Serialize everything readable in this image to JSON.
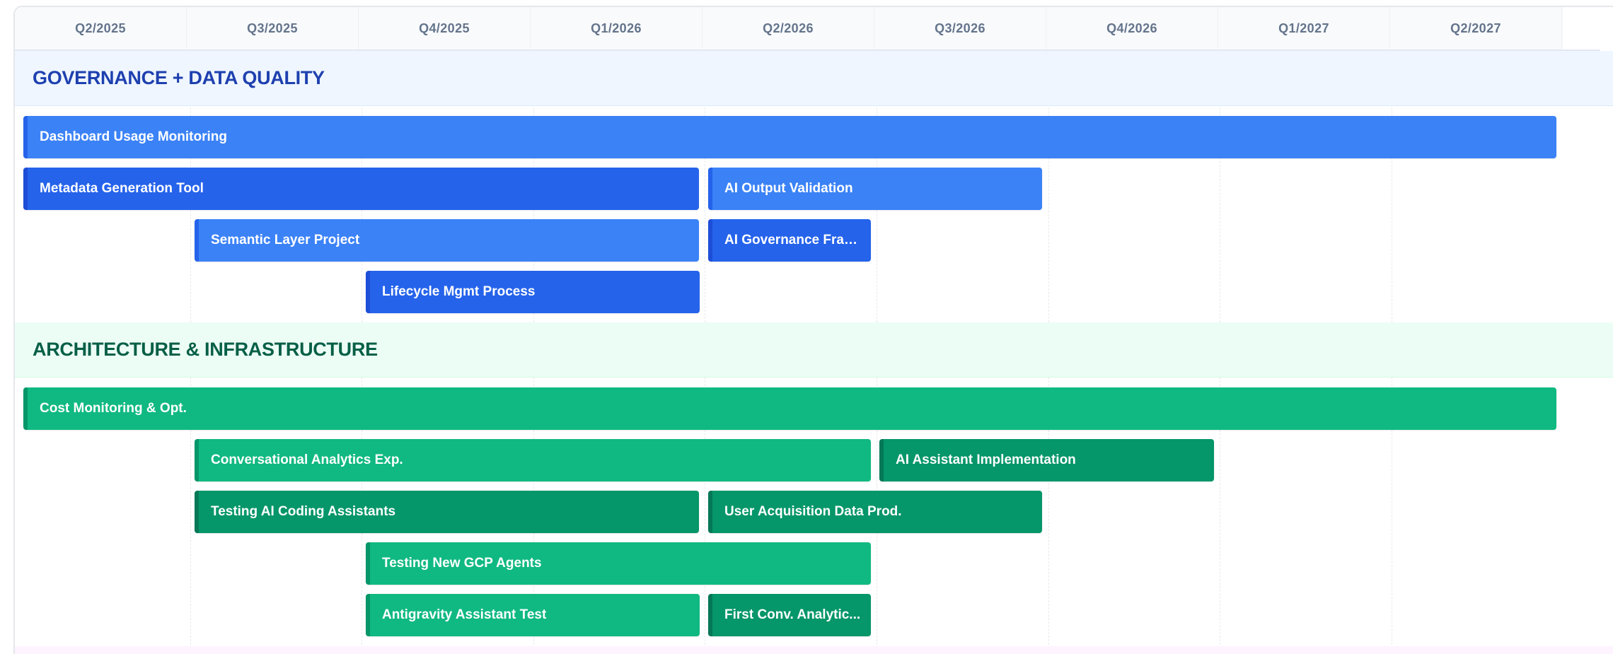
{
  "timeline": {
    "quarters": [
      "Q2/2025",
      "Q3/2025",
      "Q4/2025",
      "Q1/2026",
      "Q2/2026",
      "Q3/2026",
      "Q4/2026",
      "Q1/2027",
      "Q2/2027"
    ]
  },
  "lanes": [
    {
      "title": "GOVERNANCE + DATA QUALITY",
      "accent": "#1e40af",
      "items": [
        {
          "label": "Dashboard Usage Monitoring",
          "start": "Q2/2025",
          "end": "Q2/2027",
          "color": "#3b82f6"
        },
        {
          "label": "Metadata Generation Tool",
          "start": "Q2/2025",
          "end": "Q1/2026",
          "color": "#2563eb"
        },
        {
          "label": "AI Output Validation",
          "start": "Q2/2026",
          "end": "Q3/2026",
          "color": "#3b82f6"
        },
        {
          "label": "Semantic Layer Project",
          "start": "Q3/2025",
          "end": "Q1/2026",
          "color": "#3b82f6"
        },
        {
          "label": "AI Governance Fram...",
          "start": "Q2/2026",
          "end": "Q2/2026",
          "color": "#2563eb"
        },
        {
          "label": "Lifecycle Mgmt Process",
          "start": "Q4/2025",
          "end": "Q1/2026",
          "color": "#2563eb"
        }
      ]
    },
    {
      "title": "ARCHITECTURE & INFRASTRUCTURE",
      "accent": "#065f46",
      "items": [
        {
          "label": "Cost Monitoring & Opt.",
          "start": "Q2/2025",
          "end": "Q2/2027",
          "color": "#10b981"
        },
        {
          "label": "Conversational Analytics Exp.",
          "start": "Q3/2025",
          "end": "Q2/2026",
          "color": "#10b981"
        },
        {
          "label": "AI Assistant Implementation",
          "start": "Q3/2026",
          "end": "Q4/2026",
          "color": "#059669"
        },
        {
          "label": "Testing AI Coding Assistants",
          "start": "Q3/2025",
          "end": "Q1/2026",
          "color": "#059669"
        },
        {
          "label": "User Acquisition Data Prod.",
          "start": "Q2/2026",
          "end": "Q3/2026",
          "color": "#059669"
        },
        {
          "label": "Testing New GCP Agents",
          "start": "Q4/2025",
          "end": "Q2/2026",
          "color": "#10b981"
        },
        {
          "label": "Antigravity Assistant Test",
          "start": "Q4/2025",
          "end": "Q1/2026",
          "color": "#10b981"
        },
        {
          "label": "First Conv. Analytic...",
          "start": "Q2/2026",
          "end": "Q2/2026",
          "color": "#059669"
        }
      ]
    }
  ]
}
